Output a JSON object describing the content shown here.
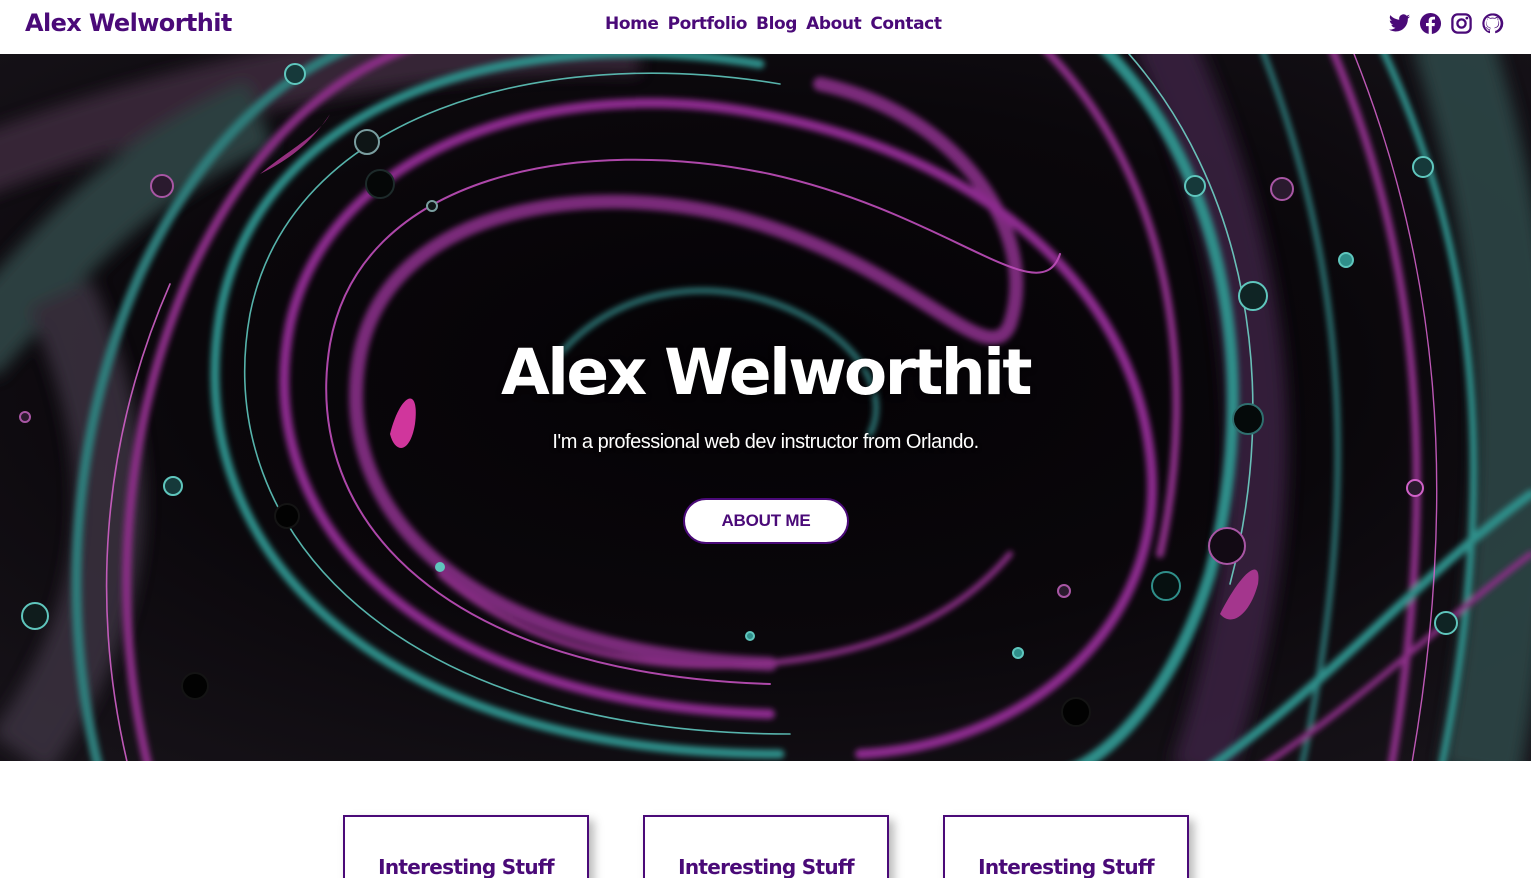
{
  "header": {
    "brand": "Alex Welworthit",
    "nav": [
      "Home",
      "Portfolio",
      "Blog",
      "About",
      "Contact"
    ],
    "social_icons": [
      "twitter-icon",
      "facebook-icon",
      "instagram-icon",
      "github-icon"
    ]
  },
  "hero": {
    "title": "Alex Welworthit",
    "subtitle": "I'm a professional web dev instructor from Orlando.",
    "button_label": "ABOUT ME"
  },
  "cards": [
    {
      "title": "Interesting Stuff"
    },
    {
      "title": "Interesting Stuff"
    },
    {
      "title": "Interesting Stuff"
    }
  ],
  "colors": {
    "brand": "#4a0a78",
    "background": "#ffffff",
    "hero_dark": "#050306",
    "accent_magenta": "#a02a9a",
    "accent_teal": "#2f8f8a"
  }
}
